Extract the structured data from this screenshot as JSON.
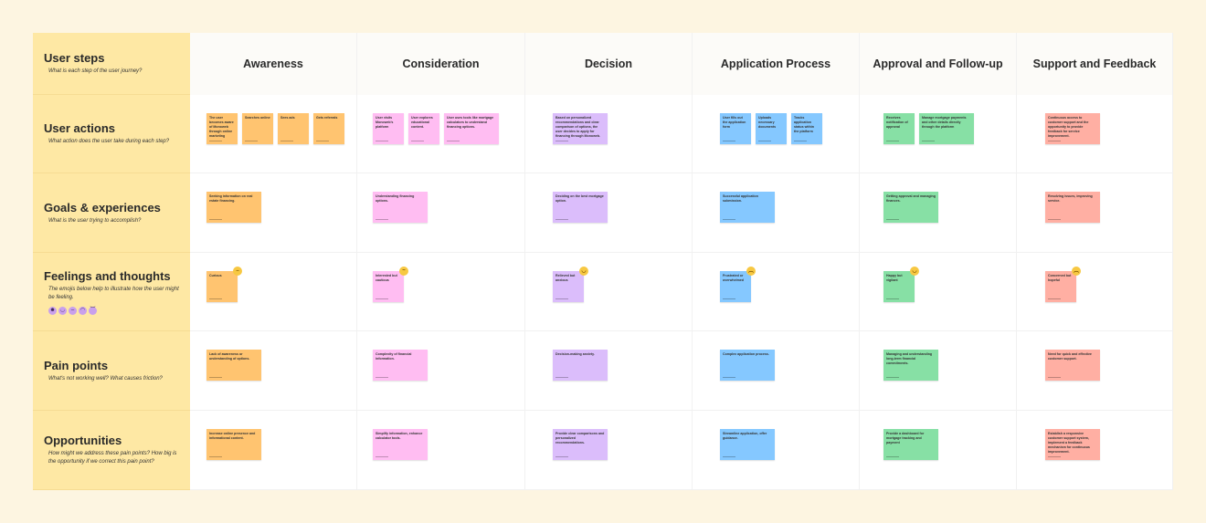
{
  "colors": {
    "awareness": "#ffc470",
    "consideration": "#ffbdf2",
    "decision": "#dbbdfb",
    "application": "#85c8ff",
    "approval": "#87e0a5",
    "support": "#ffafa3",
    "rowhead": "#fee8a4"
  },
  "corner": {
    "title": "User steps",
    "subtitle": "What is each step of the user journey?"
  },
  "stages": [
    "Awareness",
    "Consideration",
    "Decision",
    "Application Process",
    "Approval and Follow-up",
    "Support and Feedback"
  ],
  "rows": [
    {
      "title": "User actions",
      "subtitle": "What action does the user take during each step?",
      "cells": [
        [
          "The user becomes aware of Monoweb through online marketing",
          "Searches online",
          "Sees ads",
          "Gets referrals"
        ],
        [
          "User visits Monoweb's platform",
          "User explores educational content.",
          "User uses tools like mortgage calculators to understand financing options."
        ],
        [
          "Based on personalized recommendations and clear comparison of options, the user decides to apply for financing through Monoweb."
        ],
        [
          "User fills out the application form",
          "Uploads necessary documents",
          "Tracks application status within the platform"
        ],
        [
          "Receives notification of approval",
          "Manage mortgage payments and other details directly through the platform"
        ],
        [
          "Continuous access to customer support and the opportunity to provide feedback for service improvement."
        ]
      ]
    },
    {
      "title": "Goals & experiences",
      "subtitle": "What is the user trying to accomplish?",
      "cells": [
        [
          "Seeking information on real estate financing."
        ],
        [
          "Understanding financing options."
        ],
        [
          "Deciding on the best mortgage option."
        ],
        [
          "Successful application submission."
        ],
        [
          "Getting approval and managing finances."
        ],
        [
          "Resolving issues, improving service."
        ]
      ]
    },
    {
      "title": "Feelings and thoughts",
      "subtitle": "The emojis below help to illustrate how the user might be feeling.",
      "faces": [
        "very-happy-face-icon",
        "happy-face-icon",
        "neutral-face-icon",
        "sad-face-icon",
        "angry-face-icon"
      ],
      "cells": [
        [
          "Curious"
        ],
        [
          "Interested but cautious"
        ],
        [
          "Relieved but anxious"
        ],
        [
          "Frustrated or overwhelmed"
        ],
        [
          "Happy but vigilant"
        ],
        [
          "Concerned but hopeful"
        ]
      ],
      "emojis": [
        "neutral-face-icon",
        "thinking-face-icon",
        "relieved-face-icon",
        "frustrated-face-icon",
        "grinning-face-icon",
        "worried-face-icon"
      ]
    },
    {
      "title": "Pain points",
      "subtitle": "What's not working well? What causes friction?",
      "cells": [
        [
          "Lack of awareness or understanding of options."
        ],
        [
          "Complexity of financial information."
        ],
        [
          "Decision-making anxiety."
        ],
        [
          "Complex application process."
        ],
        [
          "Managing and understanding long-term financial commitments."
        ],
        [
          "Need for quick and effective customer support."
        ]
      ]
    },
    {
      "title": "Opportunities",
      "subtitle": "How might we address these pain points? How big is the opportunity if we correct this pain point?",
      "cells": [
        [
          "Increase online presence and informational content."
        ],
        [
          "Simplify information, enhance calculator tools."
        ],
        [
          "Provide clear comparisons and personalized recommendations."
        ],
        [
          "Streamline application, offer guidance."
        ],
        [
          "Provide a dashboard for mortgage tracking and payment"
        ],
        [
          "Establish a responsive customer support system, implement a feedback mechanism for continuous improvement."
        ]
      ]
    }
  ]
}
